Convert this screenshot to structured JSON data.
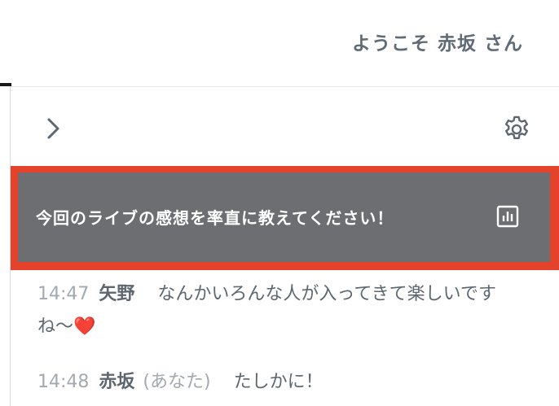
{
  "header": {
    "welcome": "ようこそ 赤坂 さん"
  },
  "toolbar": {
    "expand_icon": "chevron-right-icon",
    "settings_icon": "gear-icon"
  },
  "question": {
    "text": "今回のライブの感想を率直に教えてください！",
    "results_icon": "bar-chart-icon",
    "highlight_color": "#e4422a",
    "background_color": "#6c6e71"
  },
  "messages": [
    {
      "time": "14:47",
      "name": "矢野",
      "text": "なんかいろんな人が入ってきて楽しいですね〜❤️"
    },
    {
      "time": "14:48",
      "name": "赤坂",
      "you_label": "(あなた)",
      "text": "たしかに！"
    }
  ]
}
